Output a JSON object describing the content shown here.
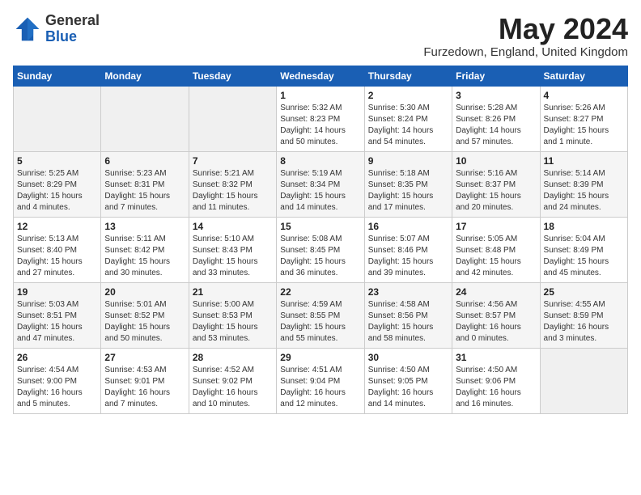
{
  "header": {
    "logo_line1": "General",
    "logo_line2": "Blue",
    "month_title": "May 2024",
    "location": "Furzedown, England, United Kingdom"
  },
  "days_of_week": [
    "Sunday",
    "Monday",
    "Tuesday",
    "Wednesday",
    "Thursday",
    "Friday",
    "Saturday"
  ],
  "weeks": [
    [
      {
        "day": "",
        "info": ""
      },
      {
        "day": "",
        "info": ""
      },
      {
        "day": "",
        "info": ""
      },
      {
        "day": "1",
        "info": "Sunrise: 5:32 AM\nSunset: 8:23 PM\nDaylight: 14 hours\nand 50 minutes."
      },
      {
        "day": "2",
        "info": "Sunrise: 5:30 AM\nSunset: 8:24 PM\nDaylight: 14 hours\nand 54 minutes."
      },
      {
        "day": "3",
        "info": "Sunrise: 5:28 AM\nSunset: 8:26 PM\nDaylight: 14 hours\nand 57 minutes."
      },
      {
        "day": "4",
        "info": "Sunrise: 5:26 AM\nSunset: 8:27 PM\nDaylight: 15 hours\nand 1 minute."
      }
    ],
    [
      {
        "day": "5",
        "info": "Sunrise: 5:25 AM\nSunset: 8:29 PM\nDaylight: 15 hours\nand 4 minutes."
      },
      {
        "day": "6",
        "info": "Sunrise: 5:23 AM\nSunset: 8:31 PM\nDaylight: 15 hours\nand 7 minutes."
      },
      {
        "day": "7",
        "info": "Sunrise: 5:21 AM\nSunset: 8:32 PM\nDaylight: 15 hours\nand 11 minutes."
      },
      {
        "day": "8",
        "info": "Sunrise: 5:19 AM\nSunset: 8:34 PM\nDaylight: 15 hours\nand 14 minutes."
      },
      {
        "day": "9",
        "info": "Sunrise: 5:18 AM\nSunset: 8:35 PM\nDaylight: 15 hours\nand 17 minutes."
      },
      {
        "day": "10",
        "info": "Sunrise: 5:16 AM\nSunset: 8:37 PM\nDaylight: 15 hours\nand 20 minutes."
      },
      {
        "day": "11",
        "info": "Sunrise: 5:14 AM\nSunset: 8:39 PM\nDaylight: 15 hours\nand 24 minutes."
      }
    ],
    [
      {
        "day": "12",
        "info": "Sunrise: 5:13 AM\nSunset: 8:40 PM\nDaylight: 15 hours\nand 27 minutes."
      },
      {
        "day": "13",
        "info": "Sunrise: 5:11 AM\nSunset: 8:42 PM\nDaylight: 15 hours\nand 30 minutes."
      },
      {
        "day": "14",
        "info": "Sunrise: 5:10 AM\nSunset: 8:43 PM\nDaylight: 15 hours\nand 33 minutes."
      },
      {
        "day": "15",
        "info": "Sunrise: 5:08 AM\nSunset: 8:45 PM\nDaylight: 15 hours\nand 36 minutes."
      },
      {
        "day": "16",
        "info": "Sunrise: 5:07 AM\nSunset: 8:46 PM\nDaylight: 15 hours\nand 39 minutes."
      },
      {
        "day": "17",
        "info": "Sunrise: 5:05 AM\nSunset: 8:48 PM\nDaylight: 15 hours\nand 42 minutes."
      },
      {
        "day": "18",
        "info": "Sunrise: 5:04 AM\nSunset: 8:49 PM\nDaylight: 15 hours\nand 45 minutes."
      }
    ],
    [
      {
        "day": "19",
        "info": "Sunrise: 5:03 AM\nSunset: 8:51 PM\nDaylight: 15 hours\nand 47 minutes."
      },
      {
        "day": "20",
        "info": "Sunrise: 5:01 AM\nSunset: 8:52 PM\nDaylight: 15 hours\nand 50 minutes."
      },
      {
        "day": "21",
        "info": "Sunrise: 5:00 AM\nSunset: 8:53 PM\nDaylight: 15 hours\nand 53 minutes."
      },
      {
        "day": "22",
        "info": "Sunrise: 4:59 AM\nSunset: 8:55 PM\nDaylight: 15 hours\nand 55 minutes."
      },
      {
        "day": "23",
        "info": "Sunrise: 4:58 AM\nSunset: 8:56 PM\nDaylight: 15 hours\nand 58 minutes."
      },
      {
        "day": "24",
        "info": "Sunrise: 4:56 AM\nSunset: 8:57 PM\nDaylight: 16 hours\nand 0 minutes."
      },
      {
        "day": "25",
        "info": "Sunrise: 4:55 AM\nSunset: 8:59 PM\nDaylight: 16 hours\nand 3 minutes."
      }
    ],
    [
      {
        "day": "26",
        "info": "Sunrise: 4:54 AM\nSunset: 9:00 PM\nDaylight: 16 hours\nand 5 minutes."
      },
      {
        "day": "27",
        "info": "Sunrise: 4:53 AM\nSunset: 9:01 PM\nDaylight: 16 hours\nand 7 minutes."
      },
      {
        "day": "28",
        "info": "Sunrise: 4:52 AM\nSunset: 9:02 PM\nDaylight: 16 hours\nand 10 minutes."
      },
      {
        "day": "29",
        "info": "Sunrise: 4:51 AM\nSunset: 9:04 PM\nDaylight: 16 hours\nand 12 minutes."
      },
      {
        "day": "30",
        "info": "Sunrise: 4:50 AM\nSunset: 9:05 PM\nDaylight: 16 hours\nand 14 minutes."
      },
      {
        "day": "31",
        "info": "Sunrise: 4:50 AM\nSunset: 9:06 PM\nDaylight: 16 hours\nand 16 minutes."
      },
      {
        "day": "",
        "info": ""
      }
    ]
  ]
}
